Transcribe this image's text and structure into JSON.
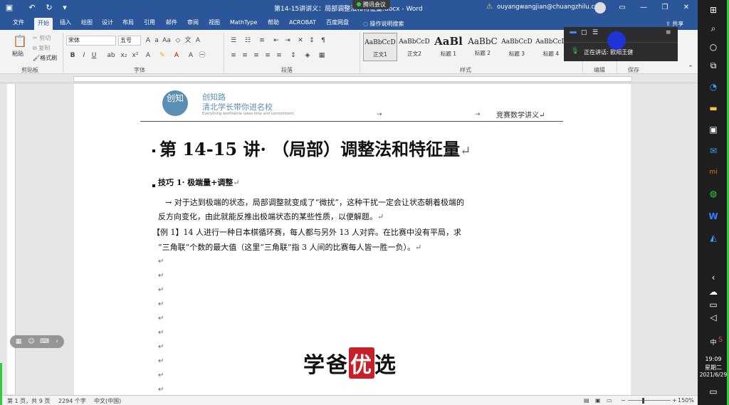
{
  "title_bar": {
    "document_title": "第14-15讲讲义：局部调整法和特征量.docx - Word",
    "meeting_app": "腾讯会议",
    "account_email": "ouyangwangjian@chuangzhilu.cn",
    "colors": {
      "bar": "#2b579a"
    }
  },
  "tabs": [
    "文件",
    "开始",
    "插入",
    "绘图",
    "设计",
    "布局",
    "引用",
    "邮件",
    "审阅",
    "视图",
    "MathType",
    "帮助",
    "ACROBAT",
    "百度网盘"
  ],
  "active_tab": "开始",
  "tell_me": "操作说明搜索",
  "share": "共享",
  "ribbon": {
    "clipboard": {
      "paste": "粘贴",
      "cut": "剪切",
      "copy": "复制",
      "format_painter": "格式刷",
      "label": "剪贴板"
    },
    "font": {
      "font_name": "宋体",
      "font_size": "五号",
      "label": "字体"
    },
    "paragraph": {
      "label": "段落"
    },
    "styles": {
      "items": [
        {
          "sample": "AaBbCcD",
          "name": "正文1"
        },
        {
          "sample": "AaBbCcD",
          "name": "正文2"
        },
        {
          "sample": "AaBl",
          "name": "标题 1"
        },
        {
          "sample": "AaBbC",
          "name": "标题 2"
        },
        {
          "sample": "AaBbCcD",
          "name": "标题 3"
        },
        {
          "sample": "AaBbCcD",
          "name": "标题 4"
        }
      ],
      "label": "样式"
    },
    "editing": {
      "label": "编辑"
    },
    "save": {
      "label": "保存"
    }
  },
  "speaking_overlay": {
    "text": "正在讲话: 欧阳王健"
  },
  "document": {
    "header": {
      "logo_text": "创知",
      "brand_name": "创知路",
      "brand_slogan": "清北学长带你进名校",
      "tagline": "Everything worthwhile takes time and commitment.",
      "right_text": "竞赛数学讲义"
    },
    "title": "第 14-15 讲· （局部）调整法和特征量",
    "section": "技巧 1· 极端量+调整",
    "paragraphs": [
      "→  对于达到极端的状态，局部调整就变成了“微扰”，这种干扰一定会让状态朝着极端的",
      "反方向变化，由此就能反推出极端状态的某些性质，以便解题。",
      "【例 1】14 人进行一种日本棋循环赛，每人都与另外 13 人对弈。在比赛中没有平局，求",
      "“三角联”个数的最大值（这里“三角联”指 3 人间的比赛每人皆一胜一负）。"
    ],
    "paragraph_mark": "↵",
    "watermark": {
      "part1": "学爸",
      "highlight": "优",
      "part2": "选",
      "highlight_color": "#c8202a"
    }
  },
  "status_bar": {
    "page": "第 1 页，共 9 页",
    "words": "2294 个字",
    "language": "中文(中国)",
    "zoom": "150%"
  },
  "taskbar": {
    "time": "19:09",
    "weekday": "星期二",
    "date": "2021/6/29",
    "ime": "中"
  }
}
